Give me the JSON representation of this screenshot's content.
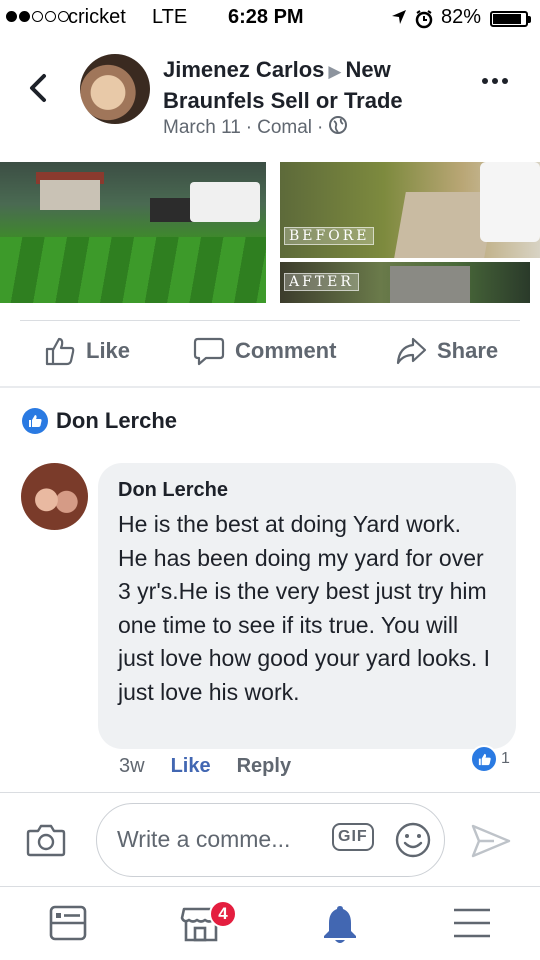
{
  "status_bar": {
    "carrier": "cricket",
    "network": "LTE",
    "time": "6:28 PM",
    "battery": "82%",
    "battery_level": 0.82
  },
  "post": {
    "author": "Jimenez Carlos",
    "group": "New Braunfels Sell or Trade",
    "date": "March 11",
    "location": "Comal",
    "photo_labels": {
      "before": "BEFORE",
      "after": "AFTER"
    }
  },
  "actions": {
    "like": "Like",
    "comment": "Comment",
    "share": "Share"
  },
  "reaction": {
    "name": "Don Lerche"
  },
  "comment": {
    "author": "Don Lerche",
    "text": "He is the best at doing Yard work. He has been doing my yard for over 3 yr's.He is the very best just try him one time to see if its true. You will just love how good your yard looks. I just love his work.",
    "age": "3w",
    "like_label": "Like",
    "reply_label": "Reply",
    "like_count": "1"
  },
  "composer": {
    "placeholder": "Write a comme...",
    "gif_label": "GIF"
  },
  "tab_bar": {
    "marketplace_badge": "4"
  },
  "colors": {
    "facebook_blue": "#4267b2",
    "like_badge_blue": "#2a7ae2",
    "notification_red": "#e41e3f",
    "secondary_text": "#606770"
  }
}
